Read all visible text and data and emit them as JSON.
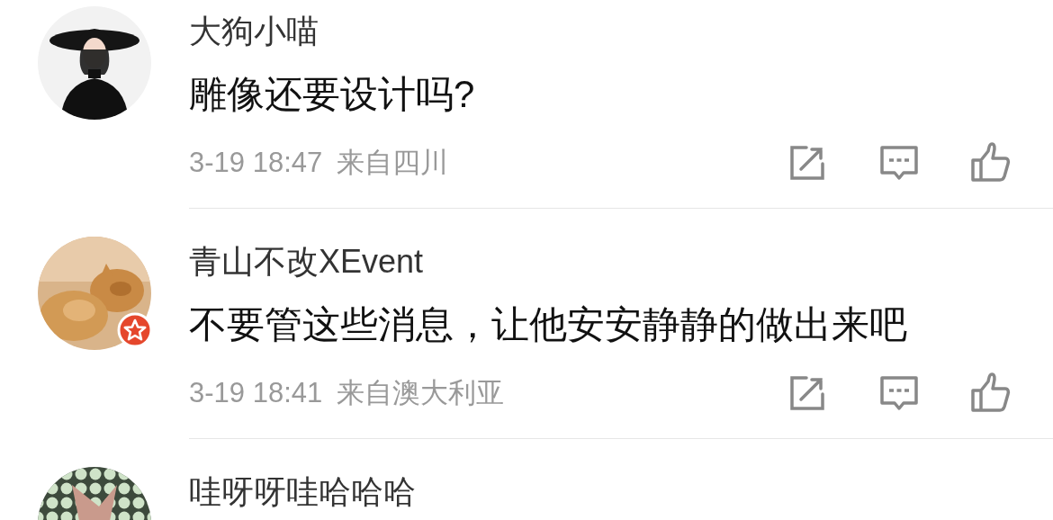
{
  "comments": [
    {
      "name": "大狗小喵",
      "text": "雕像还要设计吗?",
      "time": "3-19 18:47",
      "location": "来自四川",
      "badge": false
    },
    {
      "name": "青山不改XEvent",
      "text": "不要管这些消息，让他安安静静的做出来吧",
      "time": "3-19 18:41",
      "location": "来自澳大利亚",
      "badge": true
    },
    {
      "name": "哇呀呀哇哈哈哈",
      "badge": false
    }
  ]
}
